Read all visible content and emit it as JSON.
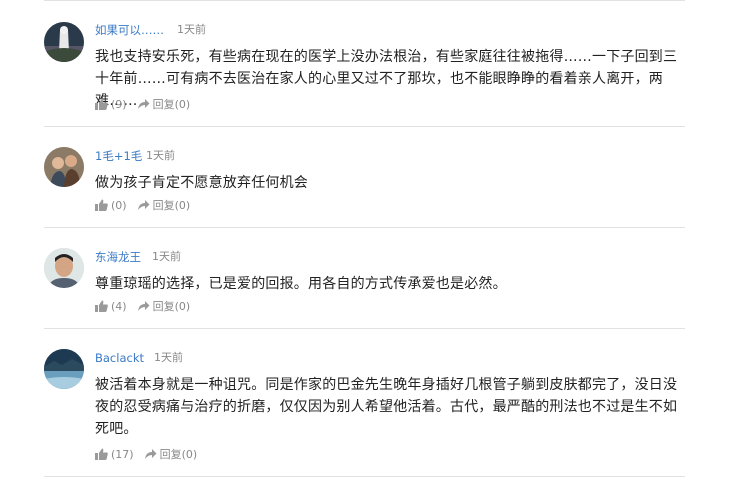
{
  "comments": [
    {
      "username": "如果可以……",
      "time": "1天前",
      "text": "我也支持安乐死，有些病在现在的医学上没办法根治，有些家庭往往被拖得……一下子回到三十年前……可有病不去医治在家人的心里又过不了那坎，也不能眼睁睁的看着亲人离开，两难……",
      "likes": "(9)",
      "reply_label": "回复",
      "reply_count": "(0)"
    },
    {
      "username": "1毛+1毛",
      "time": "1天前",
      "text": "做为孩子肯定不愿意放弃任何机会",
      "likes": "(0)",
      "reply_label": "回复",
      "reply_count": "(0)"
    },
    {
      "username": "东海龙王",
      "time": "1天前",
      "text": "尊重琼瑶的选择，已是爱的回报。用各自的方式传承爱也是必然。",
      "likes": "(4)",
      "reply_label": "回复",
      "reply_count": "(0)"
    },
    {
      "username": "Baclackt",
      "time": "1天前",
      "text": "被活着本身就是一种诅咒。同是作家的巴金先生晚年身插好几根管子躺到皮肤都完了，没日没夜的忍受病痛与治疗的折磨，仅仅因为别人希望他活着。古代，最严酷的刑法也不过是生不如死吧。",
      "likes": "(17)",
      "reply_label": "回复",
      "reply_count": "(0)"
    }
  ],
  "icons": {
    "like": "thumbs-up-icon",
    "reply": "reply-arrow-icon"
  },
  "colors": {
    "username": "#3a7ac5",
    "meta": "#888888",
    "divider": "#e2e2e2"
  }
}
